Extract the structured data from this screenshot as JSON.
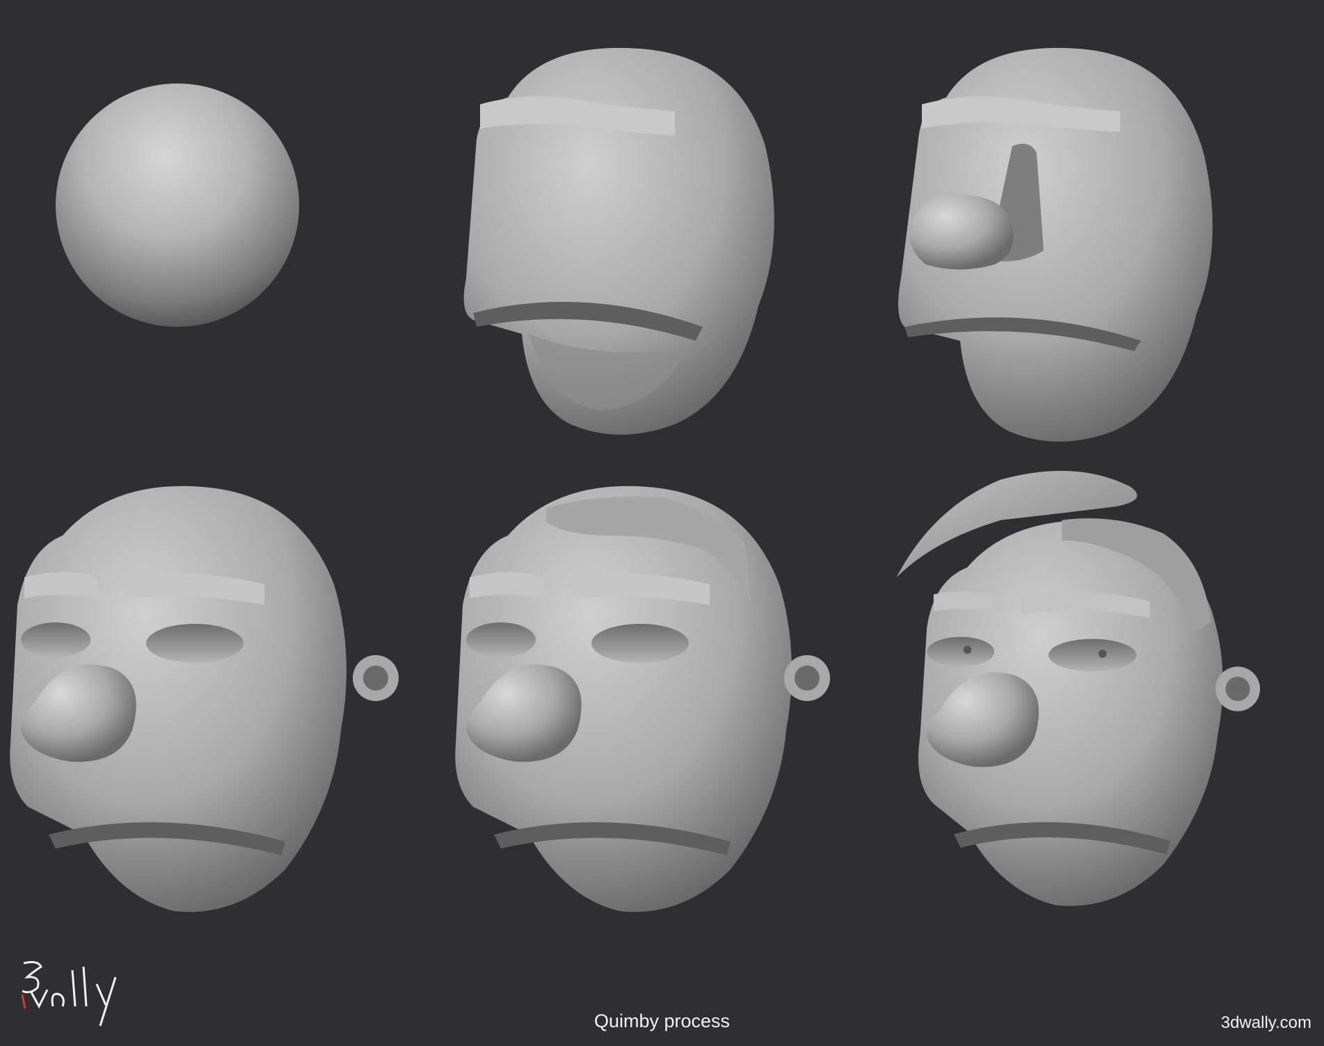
{
  "caption": "Quimby process",
  "website": "3dwally.com",
  "logo": {
    "text": "3wally",
    "icon": "3dwally-signature-logo"
  },
  "colors": {
    "background": "#2f2f31",
    "clay": "#b9b9b9",
    "text": "#f2f2f2",
    "logo_accent": "#d23a3a"
  },
  "stages": [
    {
      "id": "stage-1",
      "icon": "sphere-base"
    },
    {
      "id": "stage-2",
      "icon": "blockout-head-brows"
    },
    {
      "id": "stage-3",
      "icon": "head-with-nose-block"
    },
    {
      "id": "stage-4",
      "icon": "head-with-eyes-ear"
    },
    {
      "id": "stage-5",
      "icon": "head-with-hair-cap"
    },
    {
      "id": "stage-6",
      "icon": "head-with-swoop-hair"
    }
  ]
}
